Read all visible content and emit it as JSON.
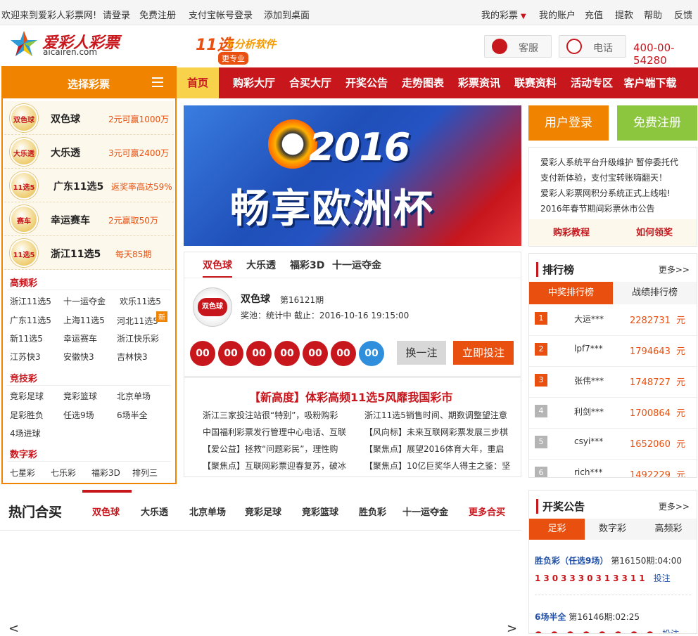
{
  "topbar": {
    "welcome": "欢迎来到爱彩人彩票网!",
    "login": "请登录",
    "register": "免费注册",
    "alipay_login": "支付宝帐号登录",
    "add_desktop": "添加到桌面",
    "my_lottery": "我的彩票",
    "my_account": "我的账户",
    "recharge": "充值",
    "withdraw": "提款",
    "help": "帮助",
    "feedback": "反馈"
  },
  "header": {
    "logo_cn": "爱彩人彩票",
    "logo_en": "aicairen.com",
    "ad_title_a": "11选",
    "ad_title_b": "5分析软件",
    "ad_badge": "更专业",
    "service_label": "客服",
    "phone_label": "电话",
    "phone_number": "400-00-54280"
  },
  "sidebar": {
    "title": "选择彩票",
    "lotteries": [
      {
        "name": "双色球",
        "prize": "2元可赢1000万",
        "logo": "双色球"
      },
      {
        "name": "大乐透",
        "prize": "3元可赢2400万",
        "logo": "大乐透"
      },
      {
        "name": "广东11选5",
        "prize": "返奖率高达59%",
        "logo": "11选5"
      },
      {
        "name": "幸运赛车",
        "prize": "2元赢取50万",
        "logo": "赛车"
      },
      {
        "name": "浙江11选5",
        "prize": "每天85期",
        "logo": "11选5"
      }
    ],
    "cat_high": "高频彩",
    "high": [
      "浙江11选5",
      "十一运夺金",
      "欢乐11选5",
      "广东11选5",
      "上海11选5",
      "河北11选5",
      "新11选5",
      "幸运赛车",
      "浙江快乐彩",
      "江苏快3",
      "安徽快3",
      "吉林快3"
    ],
    "new_tag": "新",
    "cat_skill": "竞技彩",
    "skill": [
      "竞彩足球",
      "竞彩篮球",
      "北京单场",
      "足彩胜负",
      "任选9场",
      "6场半全",
      "4场进球"
    ],
    "cat_digit": "数字彩",
    "digit": [
      "七星彩",
      "七乐彩",
      "福彩3D",
      "排列三"
    ]
  },
  "nav": [
    "首页",
    "购彩大厅",
    "合买大厅",
    "开奖公告",
    "走势图表",
    "彩票资讯",
    "联赛资料",
    "活动专区",
    "客户端下载"
  ],
  "hero": {
    "year": "2016",
    "slogan": "畅享欧洲杯"
  },
  "draw": {
    "tabs": [
      "双色球",
      "大乐透",
      "福彩3D",
      "十一运夺金"
    ],
    "logo": "双色球",
    "name": "双色球",
    "issue": "第16121期",
    "info": "奖池：统计中   截止：2016-10-16 19:15:00",
    "red": [
      "00",
      "00",
      "00",
      "00",
      "00",
      "00"
    ],
    "blue": [
      "00"
    ],
    "change_label": "换一注",
    "bet_label": "立即投注"
  },
  "news": {
    "headline": "【新高度】体彩高频11选5风靡我国彩市",
    "left": [
      "浙江三家投注站很“特别”，吸粉购彩",
      "中国福利彩票发行管理中心电话、互联",
      "【爱公益】拯救“问题彩民”，理性购",
      "【聚焦点】互联网彩票迎春复苏，破冰"
    ],
    "right": [
      "浙江11选5销售时间、期数调整望注意",
      "【风向标】未来互联网彩票发展三步棋",
      "【聚焦点】展望2016体育大年，重启",
      "【聚焦点】10亿巨奖华人得主之鉴：坚"
    ]
  },
  "account": {
    "login": "用户登录",
    "register": "免费注册"
  },
  "notice": {
    "lines": [
      "爱彩人系统平台升级维护 暂停委托代",
      "支付新体验，支付宝转账嗨翻天！",
      "爱彩人彩票网积分系统正式上线啦!",
      "2016年春节期间彩票休市公告"
    ],
    "tutorial": "购彩教程",
    "claim": "如何领奖"
  },
  "rank": {
    "title": "排行榜",
    "more": "更多>>",
    "tabs": [
      "中奖排行榜",
      "战绩排行榜"
    ],
    "unit": "元",
    "rows": [
      {
        "idx": "1",
        "user": "大运***",
        "amount": "2282731"
      },
      {
        "idx": "2",
        "user": "lpf7***",
        "amount": "1794643"
      },
      {
        "idx": "3",
        "user": "张伟***",
        "amount": "1748727"
      },
      {
        "idx": "4",
        "user": "利剑***",
        "amount": "1700864"
      },
      {
        "idx": "5",
        "user": "csyi***",
        "amount": "1652060"
      },
      {
        "idx": "6",
        "user": "rich***",
        "amount": "1492229"
      }
    ]
  },
  "hot": {
    "title": "热门合买",
    "tabs": [
      "双色球",
      "大乐透",
      "北京单场",
      "竞彩足球",
      "竞彩篮球",
      "胜负彩",
      "十一运夺金"
    ],
    "more": "更多合买",
    "prev": "<",
    "next": ">"
  },
  "open": {
    "title": "开奖公告",
    "more": "更多>>",
    "tabs": [
      "足彩",
      "数字彩",
      "高频彩"
    ],
    "r1_name": "胜负彩（任选9场）",
    "r1_issue": "第16150期:04:00",
    "r1_nums": "1303330313311",
    "r1_bet": "投注",
    "r2_name": "6场半全",
    "r2_issue": "第16146期:02:25",
    "r2_bet": "投注"
  },
  "colors": {
    "brand_red": "#c8161d",
    "orange": "#f08300",
    "accent_orange": "#e9500f",
    "green": "#8cc63f",
    "blue_ball": "#2f8fdd"
  }
}
